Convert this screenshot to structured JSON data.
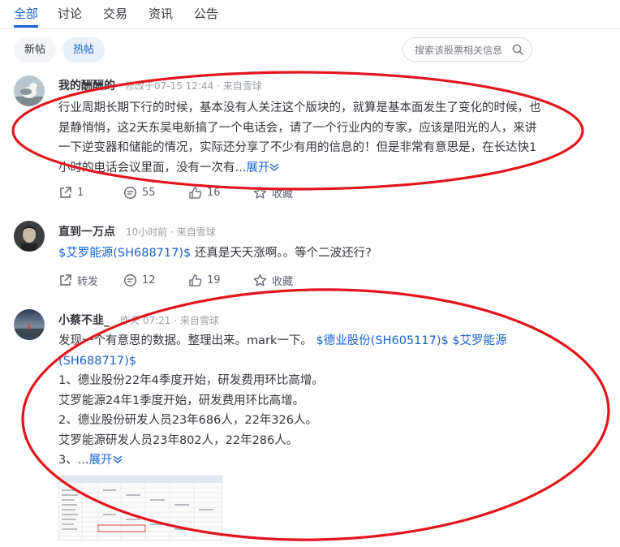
{
  "tabs": [
    "全部",
    "讨论",
    "交易",
    "资讯",
    "公告"
  ],
  "filters": {
    "new": "新帖",
    "hot": "热帖"
  },
  "search": {
    "placeholder": "搜索该股票相关信息"
  },
  "colors": {
    "accent": "#1961cf",
    "annotation": "#e2151b"
  },
  "posts": [
    {
      "user": "我的酬酬的",
      "meta": "修改于07-15 12:44 · 来自雪球",
      "body": "行业周期长期下行的时候，基本没有人关注这个版块的，就算是基本面发生了变化的时候，也是静悄悄，这2天东吴电新搞了一个电话会，请了一个行业内的专家，应该是阳光的人，来讲一下逆变器和储能的情况，实际还分享了不少有用的信息的！但是非常有意思是，在长达快1小时的电话会议里面，没有一次有...",
      "expand": "展开",
      "actions": {
        "repost": "1",
        "comments": "55",
        "likes": "16",
        "fav": "收藏"
      }
    },
    {
      "user": "直到一万点",
      "meta": "10小时前 · 来自雪球",
      "stock": "$艾罗能源(SH688717)$",
      "body": " 还真是天天涨啊。。等个二波还行?",
      "actions": {
        "repost": "转发",
        "comments": "12",
        "likes": "19",
        "fav": "收藏"
      }
    },
    {
      "user": "小蔡不韭_",
      "meta": "昨天 07:21 · 来自雪球",
      "intro": "发现一个有意思的数据。整理出来。mark一下。",
      "stock1": "$德业股份(SH605117)$",
      "stock2": "$艾罗能源(SH688717)$",
      "lines": [
        "1、德业股份22年4季度开始，研发费用环比高增。",
        "艾罗能源24年1季度开始，研发费用环比高增。",
        "2、德业股份研发人员23年686人，22年326人。",
        "艾罗能源研发人员23年802人，22年286人。"
      ],
      "line5": "3、...",
      "expand": "展开"
    }
  ]
}
